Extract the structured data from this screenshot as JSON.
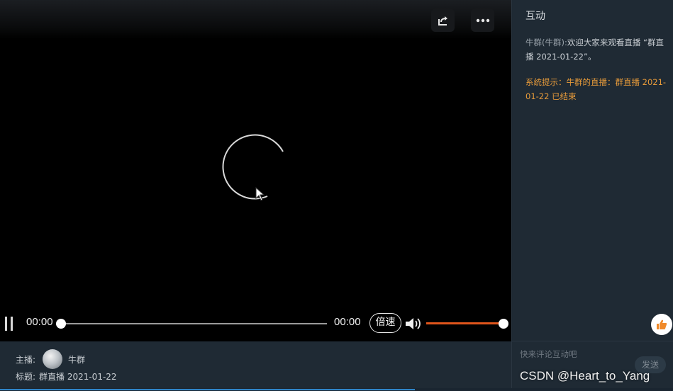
{
  "player": {
    "current_time": "00:00",
    "duration": "00:00",
    "progress_fraction": 0,
    "speed_label": "倍速",
    "volume_fraction": 1.0,
    "accent_color": "#e0561c",
    "icons": {
      "share": "share-icon",
      "more": "more-icon",
      "loading": "loading-spinner-icon",
      "cursor": "mouse-pointer-icon",
      "pause": "pause-icon",
      "volume": "volume-icon"
    }
  },
  "info": {
    "host_label": "主播:",
    "host_name": "牛群",
    "title_label": "标题:",
    "title_value": "群直播 2021-01-22"
  },
  "chat": {
    "title": "互动",
    "messages": [
      {
        "sender": "牛群(牛群):",
        "text": "欢迎大家来观看直播 “群直播 2021-01-22”。",
        "type": "user"
      },
      {
        "text": "系统提示：牛群的直播：群直播 2021-01-22 已结束",
        "type": "system",
        "color": "#e69a3a"
      }
    ],
    "input_placeholder": "快来评论互动吧",
    "send_label": "发送",
    "like_icon": "thumbs-up-icon"
  },
  "watermark": "CSDN @Heart_to_Yang"
}
